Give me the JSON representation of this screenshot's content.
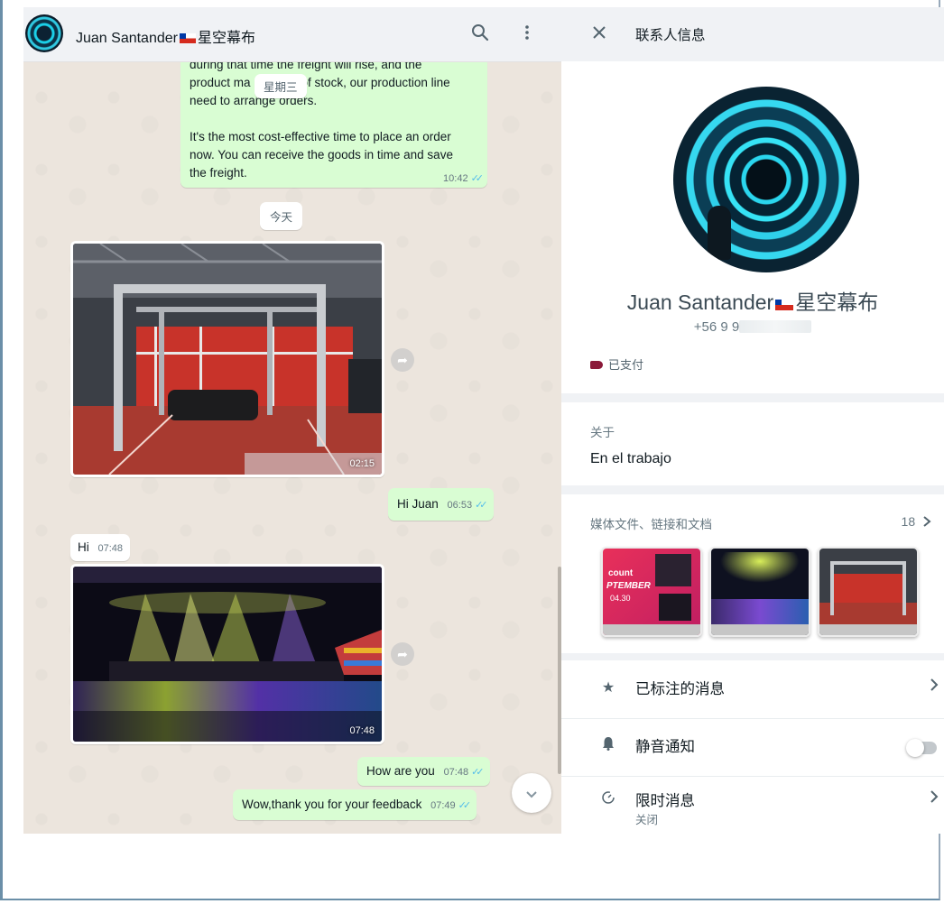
{
  "chat": {
    "contact_name": "Juan Santander",
    "contact_suffix": "星空幕布",
    "messages": {
      "long_out_lines": [
        "during that time the freight will rise, and the",
        "product ma",
        "of stock, our production line",
        "need to arrange orders."
      ],
      "long_out_para2": [
        "It's the most cost-effective time to place an order",
        "now. You can receive the goods in time and save",
        "the freight."
      ],
      "long_out_time": "10:42",
      "date_overlay": "星期三",
      "date_today": "今天",
      "photo1_time": "02:15",
      "hi_juan_text": "Hi Juan",
      "hi_juan_time": "06:53",
      "hi_text": "Hi",
      "hi_time": "07:48",
      "photo2_time": "07:48",
      "how_text": "How are you",
      "how_time": "07:48",
      "wow_text": "Wow,thank you for your feedback",
      "wow_time": "07:49"
    }
  },
  "info": {
    "title": "联系人信息",
    "name": "Juan Santander",
    "name_suffix": "星空幕布",
    "phone_prefix": "+56 9 9",
    "label": "已支付",
    "about_label": "关于",
    "about_value": "En el trabajo",
    "media_label": "媒体文件、链接和文档",
    "media_count": "18",
    "thumb1_text_a": "count",
    "thumb1_text_b": "PTEMBER",
    "thumb1_text_c": "04.30",
    "starred": "已标注的消息",
    "mute": "静音通知",
    "disappearing": "限时消息",
    "disappearing_sub": "关闭"
  },
  "colors": {
    "chat_bg": "#ece5dd",
    "outgoing_bubble": "#d9fdd3",
    "read_ticks": "#53bdeb",
    "label_tag": "#8b1a3a"
  },
  "icons": {
    "search": "search-icon",
    "menu": "kebab-menu-icon",
    "close": "close-icon",
    "forward": "forward-icon",
    "scroll_down": "chevron-down-icon",
    "starred": "star-icon",
    "mute": "bell-icon",
    "disappearing": "timer-icon",
    "chevron": "chevron-right-icon"
  }
}
